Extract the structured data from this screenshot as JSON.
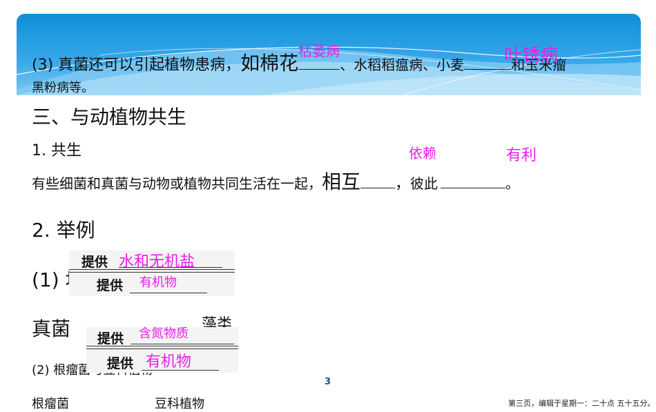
{
  "slide": {
    "item3": {
      "prefix": "(3) 真菌还可以引起植物患病，",
      "big_part": "如棉花",
      "answer1": "枯萎病",
      "mid": "、水稻稻瘟病、小麦",
      "answer2": "叶锈病",
      "suffix": "和玉米瘤",
      "line2": "黑粉病等。"
    },
    "section3_title": "三、与动植物共生",
    "sub1_title": "1. 共生",
    "symbiosis": {
      "text_before": "有些细菌和真菌与动物或植物共同生活在一起，",
      "big_part": "相互",
      "comma": "，",
      "text_mid": "彼此",
      "period": "。",
      "answer1": "依赖",
      "answer2": "有利"
    },
    "sub2_title": "2. 举例",
    "example1": {
      "label": "(1) 地",
      "left_organism": "真菌",
      "right_organism": "藻类",
      "top_provide": "提供",
      "top_answer": "水和无机盐",
      "bottom_provide": "提供",
      "bottom_answer": "有机物"
    },
    "example2": {
      "label": "(2) 根瘤菌与豆科植物",
      "left_organism": "根瘤菌",
      "right_organism": "豆科植物",
      "top_provide": "提供",
      "top_answer": "含氮物质",
      "bottom_provide": "提供",
      "bottom_answer": "有机物"
    },
    "page_number": "3",
    "footer_note": "第三页，编辑于星期一：二十点 五十五分。"
  }
}
